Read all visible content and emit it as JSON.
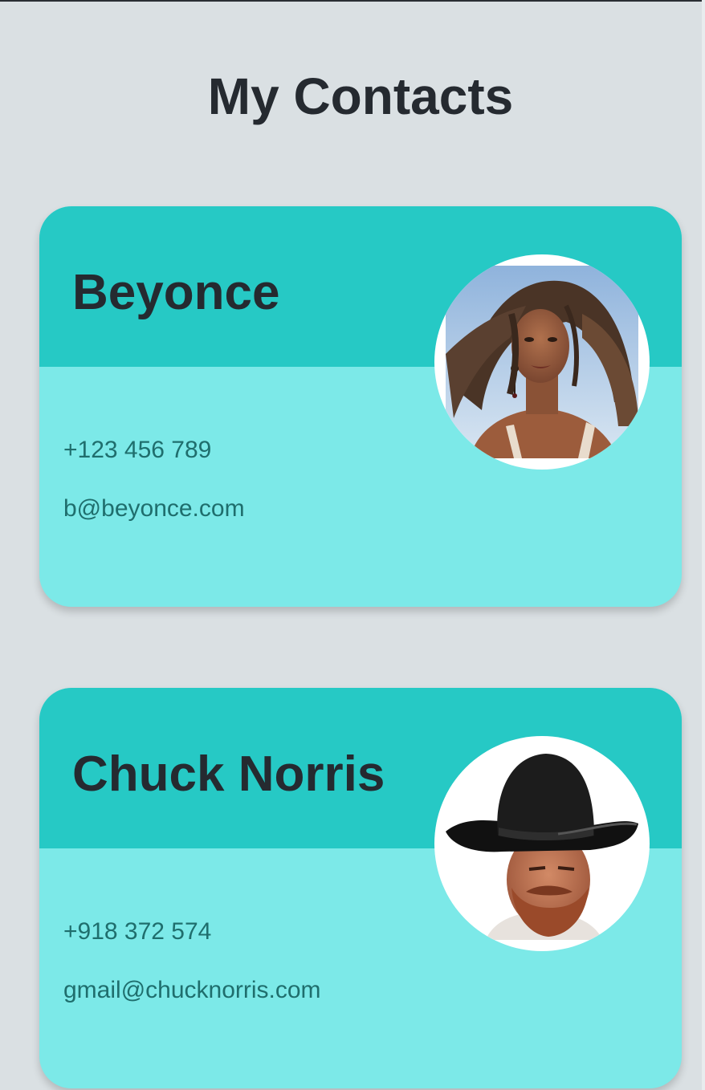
{
  "page": {
    "title": "My Contacts"
  },
  "contacts": [
    {
      "name": "Beyonce",
      "phone": "+123 456 789",
      "email": "b@beyonce.com",
      "avatar": "beyonce-avatar"
    },
    {
      "name": "Chuck Norris",
      "phone": "+918 372 574",
      "email": "gmail@chucknorris.com",
      "avatar": "chuck-norris-avatar"
    }
  ],
  "colors": {
    "background": "#dae0e3",
    "card_header": "#26c9c5",
    "card_body": "#7ce9e8",
    "title_text": "#252a30",
    "detail_text": "#1f6e6d"
  }
}
